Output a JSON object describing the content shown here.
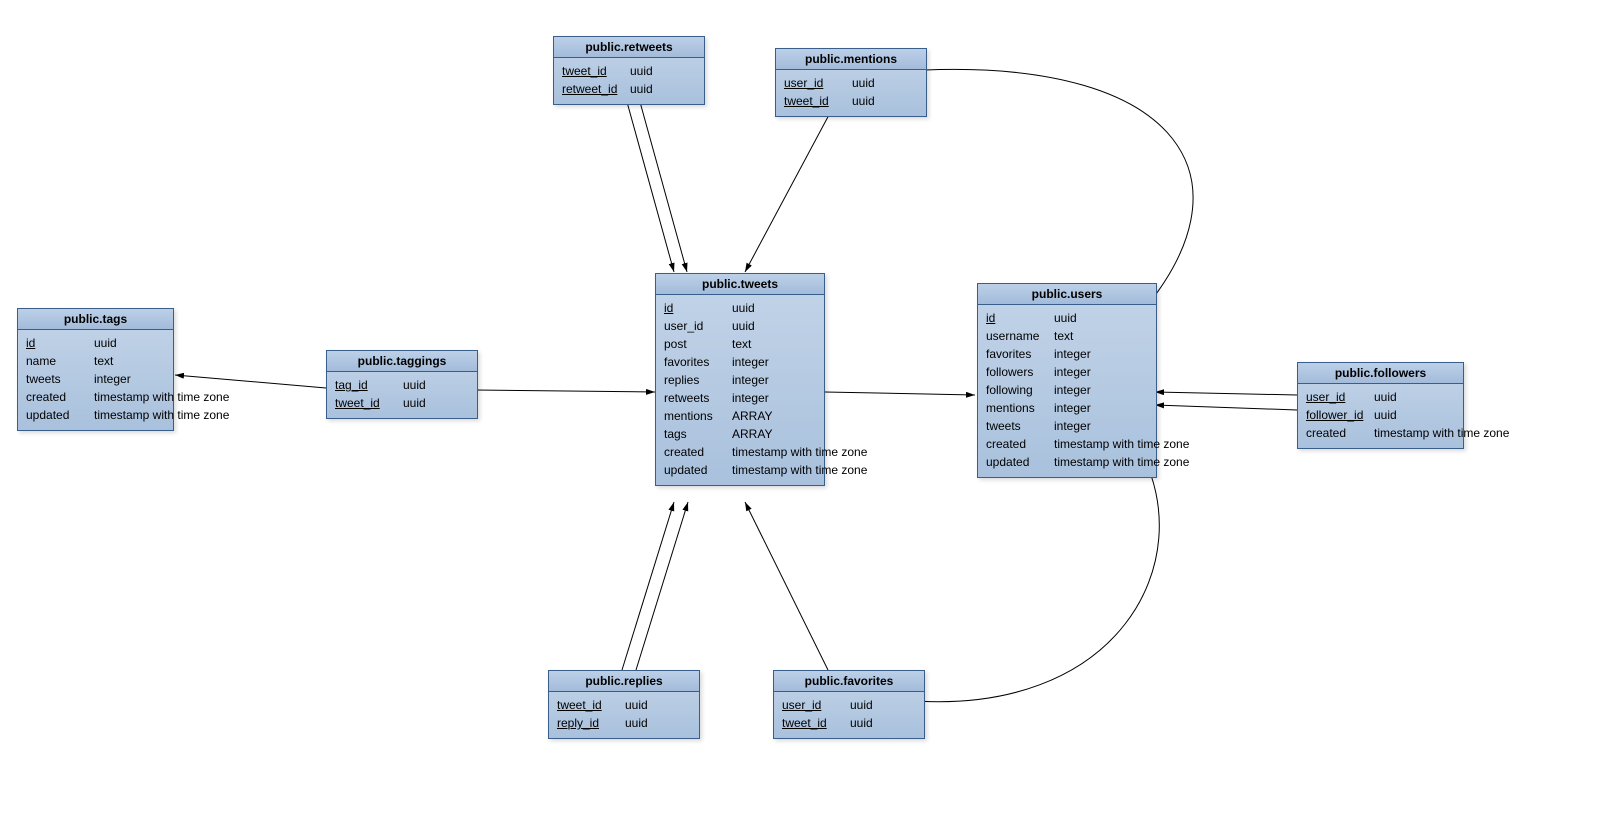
{
  "entities": {
    "retweets": {
      "title": "public.retweets",
      "columns": [
        {
          "name": "tweet_id",
          "type": "uuid",
          "pk": true
        },
        {
          "name": "retweet_id",
          "type": "uuid",
          "pk": true
        }
      ]
    },
    "mentions": {
      "title": "public.mentions",
      "columns": [
        {
          "name": "user_id",
          "type": "uuid",
          "pk": true
        },
        {
          "name": "tweet_id",
          "type": "uuid",
          "pk": true
        }
      ]
    },
    "tags": {
      "title": "public.tags",
      "columns": [
        {
          "name": "id",
          "type": "uuid",
          "pk": true
        },
        {
          "name": "name",
          "type": "text",
          "pk": false
        },
        {
          "name": "tweets",
          "type": "integer",
          "pk": false
        },
        {
          "name": "created",
          "type": "timestamp with time zone",
          "pk": false
        },
        {
          "name": "updated",
          "type": "timestamp with time zone",
          "pk": false
        }
      ]
    },
    "taggings": {
      "title": "public.taggings",
      "columns": [
        {
          "name": "tag_id",
          "type": "uuid",
          "pk": true
        },
        {
          "name": "tweet_id",
          "type": "uuid",
          "pk": true
        }
      ]
    },
    "tweets": {
      "title": "public.tweets",
      "columns": [
        {
          "name": "id",
          "type": "uuid",
          "pk": true
        },
        {
          "name": "user_id",
          "type": "uuid",
          "pk": false
        },
        {
          "name": "post",
          "type": "text",
          "pk": false
        },
        {
          "name": "favorites",
          "type": "integer",
          "pk": false
        },
        {
          "name": "replies",
          "type": "integer",
          "pk": false
        },
        {
          "name": "retweets",
          "type": "integer",
          "pk": false
        },
        {
          "name": "mentions",
          "type": "ARRAY",
          "pk": false
        },
        {
          "name": "tags",
          "type": "ARRAY",
          "pk": false
        },
        {
          "name": "created",
          "type": "timestamp with time zone",
          "pk": false
        },
        {
          "name": "updated",
          "type": "timestamp with time zone",
          "pk": false
        }
      ]
    },
    "users": {
      "title": "public.users",
      "columns": [
        {
          "name": "id",
          "type": "uuid",
          "pk": true
        },
        {
          "name": "username",
          "type": "text",
          "pk": false
        },
        {
          "name": "favorites",
          "type": "integer",
          "pk": false
        },
        {
          "name": "followers",
          "type": "integer",
          "pk": false
        },
        {
          "name": "following",
          "type": "integer",
          "pk": false
        },
        {
          "name": "mentions",
          "type": "integer",
          "pk": false
        },
        {
          "name": "tweets",
          "type": "integer",
          "pk": false
        },
        {
          "name": "created",
          "type": "timestamp with time zone",
          "pk": false
        },
        {
          "name": "updated",
          "type": "timestamp with time zone",
          "pk": false
        }
      ]
    },
    "followers": {
      "title": "public.followers",
      "columns": [
        {
          "name": "user_id",
          "type": "uuid",
          "pk": true
        },
        {
          "name": "follower_id",
          "type": "uuid",
          "pk": true
        },
        {
          "name": "created",
          "type": "timestamp with time zone",
          "pk": false
        }
      ]
    },
    "replies": {
      "title": "public.replies",
      "columns": [
        {
          "name": "tweet_id",
          "type": "uuid",
          "pk": true
        },
        {
          "name": "reply_id",
          "type": "uuid",
          "pk": true
        }
      ]
    },
    "favorites": {
      "title": "public.favorites",
      "columns": [
        {
          "name": "user_id",
          "type": "uuid",
          "pk": true
        },
        {
          "name": "tweet_id",
          "type": "uuid",
          "pk": true
        }
      ]
    }
  },
  "relationships": [
    {
      "from": "retweets",
      "to": "tweets",
      "via": "tweet_id"
    },
    {
      "from": "retweets",
      "to": "tweets",
      "via": "retweet_id"
    },
    {
      "from": "mentions",
      "to": "users",
      "via": "user_id"
    },
    {
      "from": "mentions",
      "to": "tweets",
      "via": "tweet_id"
    },
    {
      "from": "taggings",
      "to": "tags",
      "via": "tag_id"
    },
    {
      "from": "taggings",
      "to": "tweets",
      "via": "tweet_id"
    },
    {
      "from": "tweets",
      "to": "users",
      "via": "user_id"
    },
    {
      "from": "followers",
      "to": "users",
      "via": "user_id"
    },
    {
      "from": "followers",
      "to": "users",
      "via": "follower_id"
    },
    {
      "from": "replies",
      "to": "tweets",
      "via": "tweet_id"
    },
    {
      "from": "replies",
      "to": "tweets",
      "via": "reply_id"
    },
    {
      "from": "favorites",
      "to": "users",
      "via": "user_id"
    },
    {
      "from": "favorites",
      "to": "tweets",
      "via": "tweet_id"
    }
  ]
}
